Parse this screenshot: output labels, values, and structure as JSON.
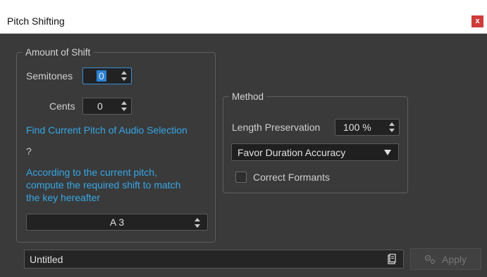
{
  "window": {
    "title": "Pitch Shifting",
    "close_label": "x"
  },
  "amount_of_shift": {
    "legend": "Amount of Shift",
    "semitones_label": "Semitones",
    "semitones_value": "0",
    "cents_label": "Cents",
    "cents_value": "0",
    "find_pitch_link": "Find Current Pitch of Audio Selection",
    "detected_pitch": "?",
    "compute_link_line1": "According to the current pitch,",
    "compute_link_line2": "compute the required shift to match",
    "compute_link_line3": "the key hereafter",
    "target_key": "A 3"
  },
  "method": {
    "legend": "Method",
    "length_preservation_label": "Length Preservation",
    "length_preservation_value": "100 %",
    "mode_selected": "Favor Duration Accuracy",
    "correct_formants_label": "Correct Formants",
    "correct_formants_checked": false
  },
  "footer": {
    "preset_name": "Untitled",
    "apply_label": "Apply"
  },
  "colors": {
    "accent": "#35a7e6",
    "background": "#3a3a3a",
    "close": "#cf3a3a"
  }
}
